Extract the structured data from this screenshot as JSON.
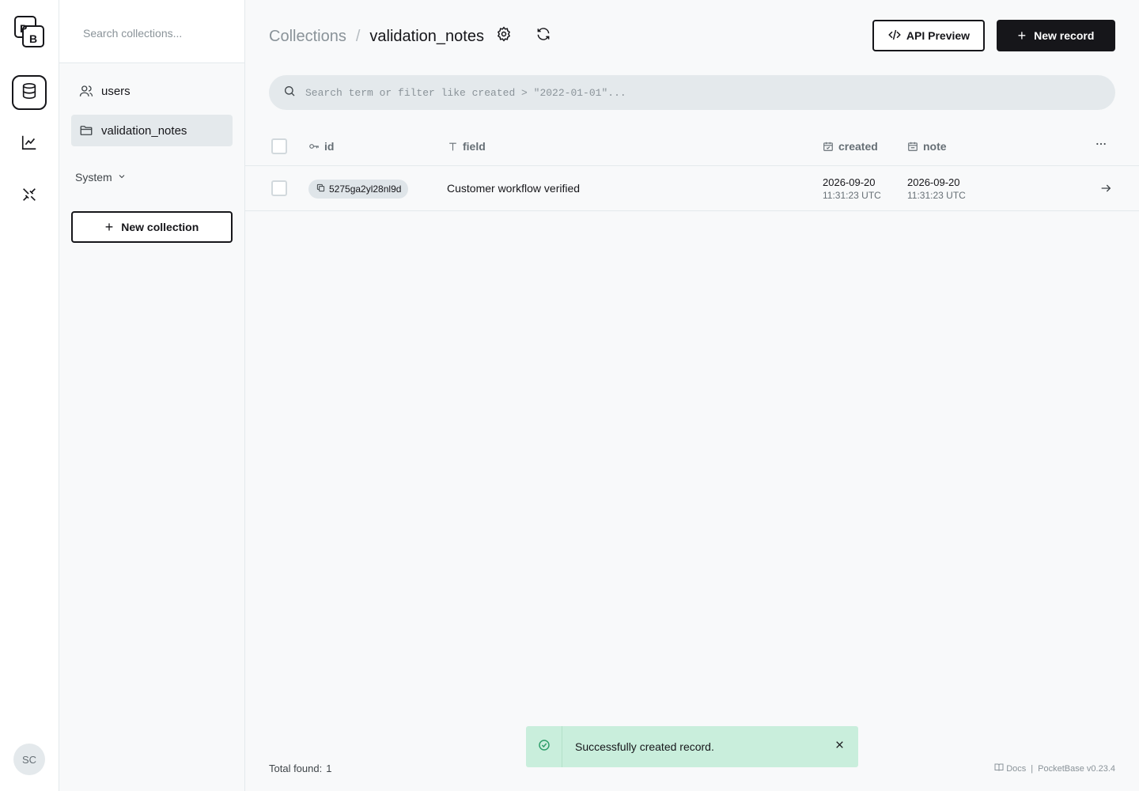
{
  "app": {
    "logo_text": "PB",
    "avatar_initials": "SC"
  },
  "sidebar": {
    "search_placeholder": "Search collections...",
    "items": [
      {
        "label": "users",
        "icon": "users-icon",
        "active": false
      },
      {
        "label": "validation_notes",
        "icon": "folder-icon",
        "active": true
      }
    ],
    "system_label": "System",
    "new_collection_label": "New collection"
  },
  "header": {
    "breadcrumb_parent": "Collections",
    "breadcrumb_separator": "/",
    "breadcrumb_current": "validation_notes",
    "api_preview_label": "API Preview",
    "new_record_label": "New record"
  },
  "filter": {
    "placeholder": "Search term or filter like created > \"2022-01-01\"..."
  },
  "table": {
    "columns": [
      {
        "label": "id",
        "icon": "key-icon"
      },
      {
        "label": "field",
        "icon": "text-icon"
      },
      {
        "label": "created",
        "icon": "calendar-icon"
      },
      {
        "label": "note",
        "icon": "calendar-icon"
      }
    ],
    "rows": [
      {
        "id": "5275ga2yl28nl9d",
        "field": "Customer workflow verified",
        "created_date": "2026-09-20",
        "created_time": "11:31:23 UTC",
        "note_date": "2026-09-20",
        "note_time": "11:31:23 UTC"
      }
    ]
  },
  "footer": {
    "total_label": "Total found:",
    "total_count": "1",
    "docs_label": "Docs",
    "separator": "|",
    "version": "PocketBase v0.23.4"
  },
  "toast": {
    "message": "Successfully created record.",
    "status_color": "#2f9e6a"
  },
  "colors": {
    "primary": "#16161a",
    "toast_bg": "#c9eedc",
    "active_item_bg": "#e4e9ec"
  }
}
